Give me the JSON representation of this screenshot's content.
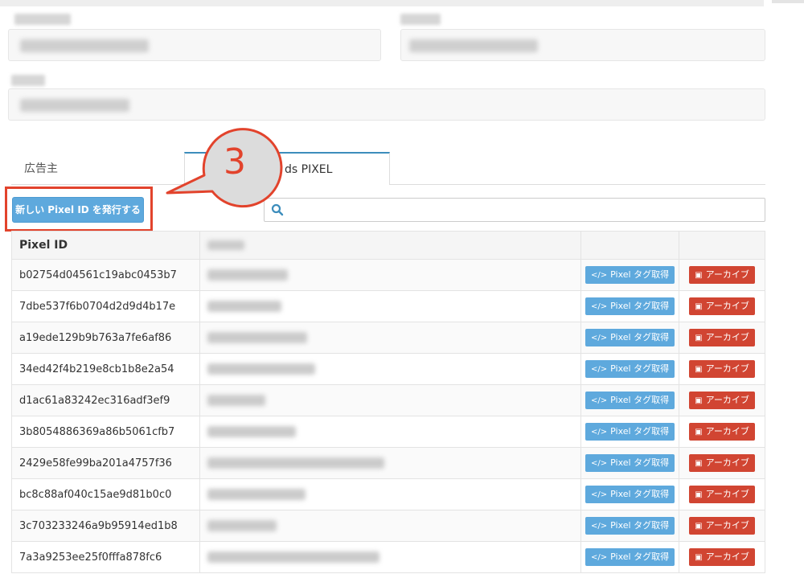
{
  "tabs": [
    {
      "label": "広告主"
    },
    {
      "label": "ds PIXEL"
    }
  ],
  "new_button": {
    "label": "新しい Pixel ID を発行する"
  },
  "search": {
    "placeholder": ""
  },
  "annotation": {
    "step": "3"
  },
  "table": {
    "headers": [
      "Pixel ID",
      "",
      "",
      ""
    ],
    "tag_button_label": "Pixel タグ取得",
    "archive_button_label": "アーカイブ",
    "rows": [
      {
        "pixel_id": "b02754d04561c19abc0453b7"
      },
      {
        "pixel_id": "7dbe537f6b0704d2d9d4b17e"
      },
      {
        "pixel_id": "a19ede129b9b763a7fe6af86"
      },
      {
        "pixel_id": "34ed42f4b219e8cb1b8e2a54"
      },
      {
        "pixel_id": "d1ac61a83242ec316adf3ef9"
      },
      {
        "pixel_id": "3b8054886369a86b5061cfb7"
      },
      {
        "pixel_id": "2429e58fe99ba201a4757f36"
      },
      {
        "pixel_id": "bc8c88af040c15ae9d81b0c0"
      },
      {
        "pixel_id": "3c703233246a9b95914ed1b8"
      },
      {
        "pixel_id": "7a3a9253ee25f0fffa878fc6"
      }
    ]
  },
  "colors": {
    "primary": "#5ea9dd",
    "danger": "#d14532",
    "annotation": "#e2432c"
  }
}
